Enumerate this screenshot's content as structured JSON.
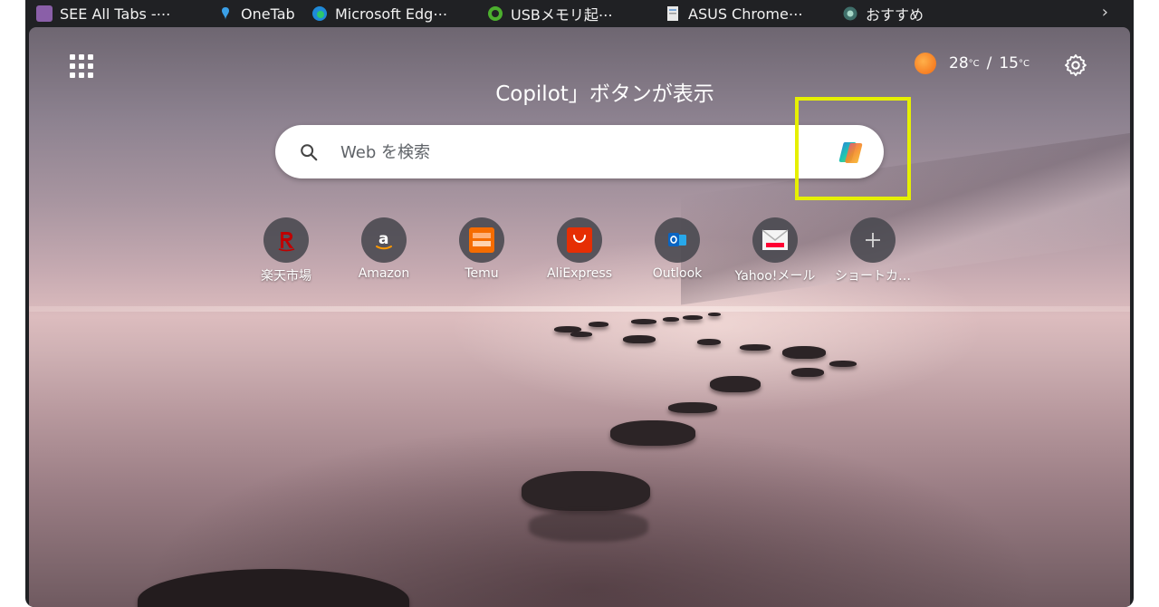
{
  "bookmarks": [
    {
      "label": "SEE All Tabs -⋯",
      "icon": "see-all-tabs-icon",
      "color": "#8a5fa8"
    },
    {
      "label": "OneTab",
      "icon": "onetab-pin-icon",
      "color": "#3aa0e8"
    },
    {
      "label": "Microsoft Edg⋯",
      "icon": "edge-icon",
      "color": "#1f8ad8"
    },
    {
      "label": "USBメモリ起⋯",
      "icon": "usb-site-icon",
      "color": "#4caf2e"
    },
    {
      "label": "ASUS Chrome⋯",
      "icon": "document-icon",
      "color": "#dddddd"
    },
    {
      "label": "おすすめ",
      "icon": "globe-icon",
      "color": "#6fa8a0"
    }
  ],
  "bookmarks_more": "›",
  "weather": {
    "high": "28",
    "low": "15",
    "unit": "°C",
    "separator": "/"
  },
  "title": "Copilot」ボタンが表示",
  "search": {
    "placeholder": "Web を検索"
  },
  "quick_links": [
    {
      "label": "楽天市場",
      "icon": "rakuten-icon"
    },
    {
      "label": "Amazon",
      "icon": "amazon-icon"
    },
    {
      "label": "Temu",
      "icon": "temu-icon"
    },
    {
      "label": "AliExpress",
      "icon": "aliexpress-icon"
    },
    {
      "label": "Outlook",
      "icon": "outlook-icon"
    },
    {
      "label": "Yahoo!メール",
      "icon": "yahoo-mail-icon"
    },
    {
      "label": "ショートカ…",
      "icon": "add-icon"
    }
  ],
  "colors": {
    "highlight": "#e6f000",
    "frame": "#202124"
  }
}
